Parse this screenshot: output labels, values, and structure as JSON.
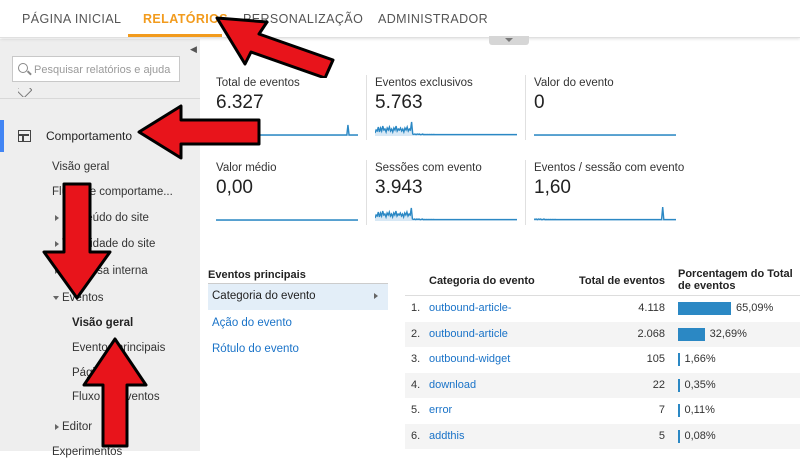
{
  "topnav": {
    "tabs": [
      {
        "label": "PÁGINA INICIAL",
        "active": false
      },
      {
        "label": "RELATÓRIOS",
        "active": true
      },
      {
        "label": "PERSONALIZAÇÃO",
        "active": false
      },
      {
        "label": "ADMINISTRADOR",
        "active": false
      }
    ],
    "accent_color": "#f29b1d"
  },
  "sidebar": {
    "search_placeholder": "Pesquisar relatórios e ajuda",
    "section_label": "Comportamento",
    "items": [
      {
        "label": "Visão geral"
      },
      {
        "label": "Fluxo de comportame..."
      },
      {
        "label": "Conteúdo do site"
      },
      {
        "label": "Velocidade do site"
      },
      {
        "label": "Pesquisa interna"
      },
      {
        "label": "Eventos"
      },
      {
        "label": "Visão geral"
      },
      {
        "label": "Eventos principais"
      },
      {
        "label": "Páginas"
      },
      {
        "label": "Fluxo de eventos"
      },
      {
        "label": "Editor"
      },
      {
        "label": "Experimentos"
      }
    ]
  },
  "metrics": [
    {
      "title": "Total de eventos",
      "value": "6.327",
      "sparkline": [
        0.9,
        0.95,
        0.9,
        0.85,
        0.95,
        0.9,
        0.7,
        0.95,
        0.9,
        0.95,
        0.9,
        0.95,
        0.92,
        0.95,
        0.9,
        0.95,
        0.93,
        0.95,
        0.9,
        0.95,
        0.95,
        0.95,
        0.95,
        0.95,
        0.95,
        0.94,
        0.95,
        0.95,
        0.95,
        0.95,
        0.95,
        0.95,
        0.95,
        0.95,
        0.95,
        0.95,
        0.95,
        0.95,
        0.95,
        0.95,
        0.95,
        0.95,
        0.95,
        0.95,
        0.95,
        0.95,
        0.95,
        0.95,
        0.95,
        0.95,
        0.95,
        0.95,
        0.95,
        0.95,
        0.95,
        0.95,
        0.95,
        0.95,
        0.95,
        0.95,
        0.95,
        0.95,
        0.95,
        0.95,
        0.95,
        0.95,
        0.95,
        0.95,
        0.95,
        0.95,
        0.95,
        0.95,
        0.95,
        0.95,
        0.95,
        0.95,
        0.95,
        0.95,
        0.95,
        0.95,
        0.95,
        0.95,
        0.95,
        0.95,
        0.95,
        0.95,
        0.95,
        0.95,
        0.95,
        0.95,
        0.95,
        0.95,
        0.95,
        0.95,
        0.95,
        0.95,
        0.95,
        0.95,
        0.95,
        0.95,
        0.95,
        0.95,
        0.95,
        0.95,
        0.95,
        0.95,
        0.95,
        0.95,
        0.95,
        0.95,
        0.95,
        0.95,
        0.95,
        0.95,
        0.95,
        0.95,
        0.95,
        0.95,
        0.45,
        0.95,
        0.95,
        0.95,
        0.95,
        0.95,
        0.95,
        0.95,
        0.95,
        0.95
      ]
    },
    {
      "title": "Eventos exclusivos",
      "value": "5.763",
      "sparkline": [
        0.85,
        0.7,
        0.75,
        0.55,
        0.8,
        0.6,
        0.75,
        0.5,
        0.7,
        0.65,
        0.8,
        0.6,
        0.7,
        0.55,
        0.75,
        0.65,
        0.8,
        0.6,
        0.7,
        0.5,
        0.75,
        0.65,
        0.7,
        0.6,
        0.75,
        0.65,
        0.8,
        0.6,
        0.7,
        0.55,
        0.75,
        0.65,
        0.7,
        0.3,
        0.9,
        0.92,
        0.9,
        0.93,
        0.9,
        0.92,
        0.9,
        0.93,
        0.92,
        0.9,
        0.93,
        0.92,
        0.93,
        0.92,
        0.93,
        0.92,
        0.93,
        0.92,
        0.93,
        0.92,
        0.93,
        0.93,
        0.93,
        0.93,
        0.93,
        0.93,
        0.93,
        0.93,
        0.93,
        0.93,
        0.93,
        0.93,
        0.93,
        0.93,
        0.93,
        0.93,
        0.93,
        0.93,
        0.93,
        0.93,
        0.93,
        0.93,
        0.93,
        0.93,
        0.93,
        0.93,
        0.93,
        0.93,
        0.93,
        0.93,
        0.93,
        0.93,
        0.93,
        0.93,
        0.93,
        0.93,
        0.93,
        0.93,
        0.93,
        0.93,
        0.93,
        0.93,
        0.93,
        0.93,
        0.93,
        0.93,
        0.93,
        0.93,
        0.93,
        0.93,
        0.93,
        0.93,
        0.93,
        0.93,
        0.93,
        0.93,
        0.93,
        0.93,
        0.93,
        0.93,
        0.93,
        0.93,
        0.93,
        0.93,
        0.93,
        0.93,
        0.93,
        0.93,
        0.93,
        0.93,
        0.93,
        0.93,
        0.93,
        0.93,
        0.93
      ]
    },
    {
      "title": "Valor do evento",
      "value": "0",
      "sparkline": [
        0.95,
        0.95
      ]
    },
    {
      "title": "Valor médio",
      "value": "0,00",
      "sparkline": [
        0.95,
        0.95
      ]
    },
    {
      "title": "Sessões com evento",
      "value": "3.943",
      "sparkline": [
        0.85,
        0.7,
        0.75,
        0.55,
        0.8,
        0.6,
        0.75,
        0.5,
        0.7,
        0.65,
        0.8,
        0.6,
        0.7,
        0.55,
        0.75,
        0.65,
        0.8,
        0.6,
        0.7,
        0.5,
        0.75,
        0.65,
        0.7,
        0.6,
        0.75,
        0.65,
        0.8,
        0.6,
        0.7,
        0.55,
        0.75,
        0.65,
        0.7,
        0.35,
        0.9,
        0.92,
        0.9,
        0.93,
        0.9,
        0.92,
        0.9,
        0.93,
        0.92,
        0.9,
        0.93,
        0.92,
        0.93,
        0.92,
        0.93,
        0.92,
        0.93,
        0.92,
        0.93,
        0.92,
        0.93,
        0.93,
        0.93,
        0.93,
        0.93,
        0.93,
        0.93,
        0.93,
        0.93,
        0.93,
        0.93,
        0.93,
        0.93,
        0.93,
        0.93,
        0.93,
        0.93,
        0.93,
        0.93,
        0.93,
        0.93,
        0.93,
        0.93,
        0.93,
        0.93,
        0.93,
        0.93,
        0.93,
        0.93,
        0.93,
        0.93,
        0.93,
        0.93,
        0.93,
        0.93,
        0.93,
        0.93,
        0.93,
        0.93,
        0.93,
        0.93,
        0.93,
        0.93,
        0.93,
        0.93,
        0.93,
        0.93,
        0.93,
        0.93,
        0.93,
        0.93,
        0.93,
        0.93,
        0.93,
        0.93,
        0.93,
        0.93,
        0.93,
        0.93,
        0.93,
        0.93,
        0.93,
        0.93,
        0.93,
        0.93,
        0.93,
        0.93,
        0.93,
        0.93,
        0.93,
        0.93,
        0.93,
        0.93,
        0.93,
        0.93,
        0.93
      ]
    },
    {
      "title": "Eventos / sessão com evento",
      "value": "1,60",
      "sparkline": [
        0.9,
        0.92,
        0.9,
        0.93,
        0.9,
        0.92,
        0.9,
        0.93,
        0.92,
        0.9,
        0.93,
        0.92,
        0.93,
        0.92,
        0.93,
        0.92,
        0.93,
        0.92,
        0.93,
        0.92,
        0.93,
        0.93,
        0.93,
        0.93,
        0.93,
        0.93,
        0.93,
        0.93,
        0.93,
        0.93,
        0.93,
        0.93,
        0.93,
        0.93,
        0.93,
        0.93,
        0.93,
        0.93,
        0.93,
        0.93,
        0.93,
        0.93,
        0.93,
        0.93,
        0.93,
        0.93,
        0.93,
        0.93,
        0.93,
        0.93,
        0.93,
        0.93,
        0.93,
        0.93,
        0.93,
        0.93,
        0.93,
        0.93,
        0.93,
        0.93,
        0.93,
        0.93,
        0.93,
        0.93,
        0.93,
        0.93,
        0.93,
        0.93,
        0.93,
        0.93,
        0.93,
        0.93,
        0.93,
        0.93,
        0.93,
        0.93,
        0.93,
        0.93,
        0.93,
        0.93,
        0.93,
        0.93,
        0.93,
        0.93,
        0.93,
        0.93,
        0.93,
        0.93,
        0.93,
        0.93,
        0.93,
        0.93,
        0.93,
        0.93,
        0.93,
        0.93,
        0.93,
        0.93,
        0.93,
        0.93,
        0.93,
        0.93,
        0.93,
        0.93,
        0.93,
        0.93,
        0.93,
        0.93,
        0.93,
        0.93,
        0.93,
        0.93,
        0.93,
        0.93,
        0.93,
        0.93,
        0.3,
        0.93,
        0.93,
        0.93,
        0.93,
        0.93,
        0.93,
        0.93,
        0.93,
        0.93,
        0.93,
        0.93,
        0.93
      ]
    }
  ],
  "events_panel": {
    "heading": "Eventos principais",
    "selected": "Categoria do evento",
    "links": [
      "Ação do evento",
      "Rótulo do evento"
    ]
  },
  "table": {
    "headers": {
      "category": "Categoria do evento",
      "total": "Total de eventos",
      "pct": "Porcentagem do Total de eventos"
    },
    "rows": [
      {
        "n": "1.",
        "category": "outbound-article-",
        "total": "4.118",
        "pct": "65,09%",
        "fraction": 0.6509
      },
      {
        "n": "2.",
        "category": "outbound-article",
        "total": "2.068",
        "pct": "32,69%",
        "fraction": 0.3269
      },
      {
        "n": "3.",
        "category": "outbound-widget",
        "total": "105",
        "pct": "1,66%",
        "fraction": 0.0166
      },
      {
        "n": "4.",
        "category": "download",
        "total": "22",
        "pct": "0,35%",
        "fraction": 0.0035
      },
      {
        "n": "5.",
        "category": "error",
        "total": "7",
        "pct": "0,11%",
        "fraction": 0.0011
      },
      {
        "n": "6.",
        "category": "addthis",
        "total": "5",
        "pct": "0,08%",
        "fraction": 0.0008
      }
    ],
    "bar_color": "#2b88c4"
  },
  "annotation_color": "#e8141b"
}
